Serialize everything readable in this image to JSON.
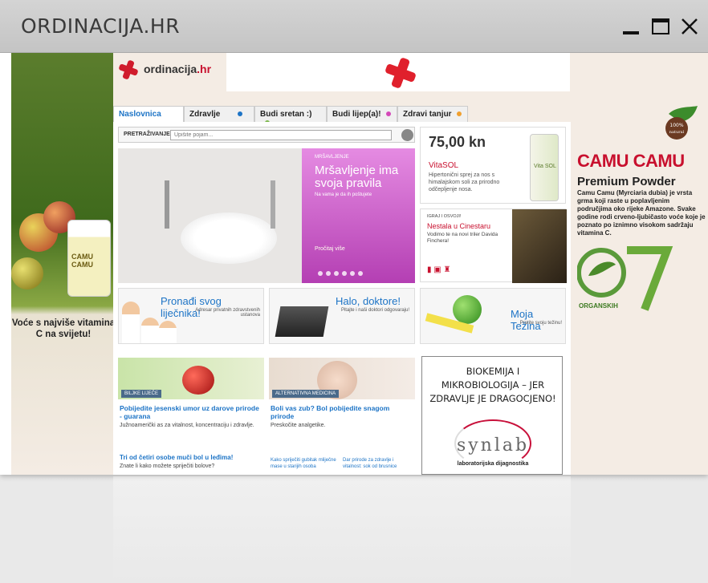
{
  "window": {
    "title": "ORDINACIJA.HR",
    "controls": {
      "minimize_icon": "minimize-icon",
      "maximize_icon": "maximize-icon",
      "close_icon": "close-icon"
    }
  },
  "site": {
    "logo": {
      "main": "ordinacija",
      "tld": ".hr"
    },
    "tabs": [
      {
        "label": "Naslovnica",
        "active": true
      },
      {
        "label": "Zdravlje",
        "dot_color": "#1d74c6"
      },
      {
        "label": "Budi sretan :)",
        "dot_color": "#7ab648"
      },
      {
        "label": "Budi lijep(a)!",
        "dot_color": "#d448b8"
      },
      {
        "label": "Zdravi tanjur",
        "dot_color": "#f0a030"
      }
    ],
    "search": {
      "label": "PRETRAŽIVANJE",
      "placeholder": "Upišite pojam..."
    },
    "hero": {
      "kicker": "MRŠAVLJENJE",
      "title": "Mršavljenje ima svoja pravila",
      "subtitle": "Na vama je da ih poštujete",
      "more": "Pročitaj više",
      "slides": 6
    },
    "promo": {
      "price": "75,00 kn",
      "name": "VitaSOL",
      "text": "Hipertonični sprej za nos s himalajskom soli za prirodno odčepljenje nosa.",
      "bottle_label": "Vita SOL"
    },
    "cinema": {
      "kicker": "IGRAJ I OSVOJI!",
      "title": "Nestala u Cinestaru",
      "text": "Vodimo te na novi triler Davida Finchera!"
    },
    "cards": [
      {
        "title": "Pronađi svog liječnika!",
        "sub": "Adresar privatnih zdravstvenih ustanova"
      },
      {
        "title": "Halo, doktore!",
        "sub": "Pitajte i naši doktori odgovaraju!"
      },
      {
        "title": "Moja Težina",
        "sub": "Pratite svoju težinu!"
      }
    ],
    "news": [
      {
        "category": "BILJKE LIJEČE",
        "title": "Pobijedite jesenski umor uz darove prirode - guarana",
        "text": "Južnoamerički as za vitalnost, koncentraciju i zdravlje."
      },
      {
        "category": "ALTERNATIVNA MEDICINA",
        "title": "Boli vas zub? Bol pobijedite snagom prirode",
        "text": "Preskočite analgetike."
      }
    ],
    "news_more": {
      "title": "Tri od četiri osobe muči bol u leđima!",
      "text": "Znate li kako možete spriječiti bolove?",
      "link1": "Kako spriječiti gubitak mliječne mase u starijih osoba",
      "link2": "Dar prirode za zdravlje i vitalnost: sok od brusnice"
    },
    "sidebar_ad": {
      "headline": [
        "BIOKEMIJA I",
        "MIKROBIOLOGIJA – JER",
        "ZDRAVLJE JE DRAGOCJENO!"
      ],
      "brand": "synlab",
      "brand_sub": "laboratorijska dijagnostika"
    }
  },
  "left_ad": {
    "caption": "Voće s najviše vitamina C na svijetu!",
    "jar_label": "CAMU CAMU"
  },
  "right_ad": {
    "badge": "100% natural",
    "title": "CAMU CAMU",
    "subtitle": "Premium Powder",
    "text": "Camu Camu (Myrciaria dubia) je vrsta grma koji raste u poplavljenim područjima oko rijeke Amazone. Svake godine rodi crveno-ljubičasto voće koje je poznato po iznimno visokom sadržaju vitamina C.",
    "logo_text": "ORGANSKIH",
    "logo_number": "7"
  },
  "colors": {
    "brand_red": "#c8102e",
    "link_blue": "#1d74c6",
    "hero_pink": "#d45bd2"
  }
}
